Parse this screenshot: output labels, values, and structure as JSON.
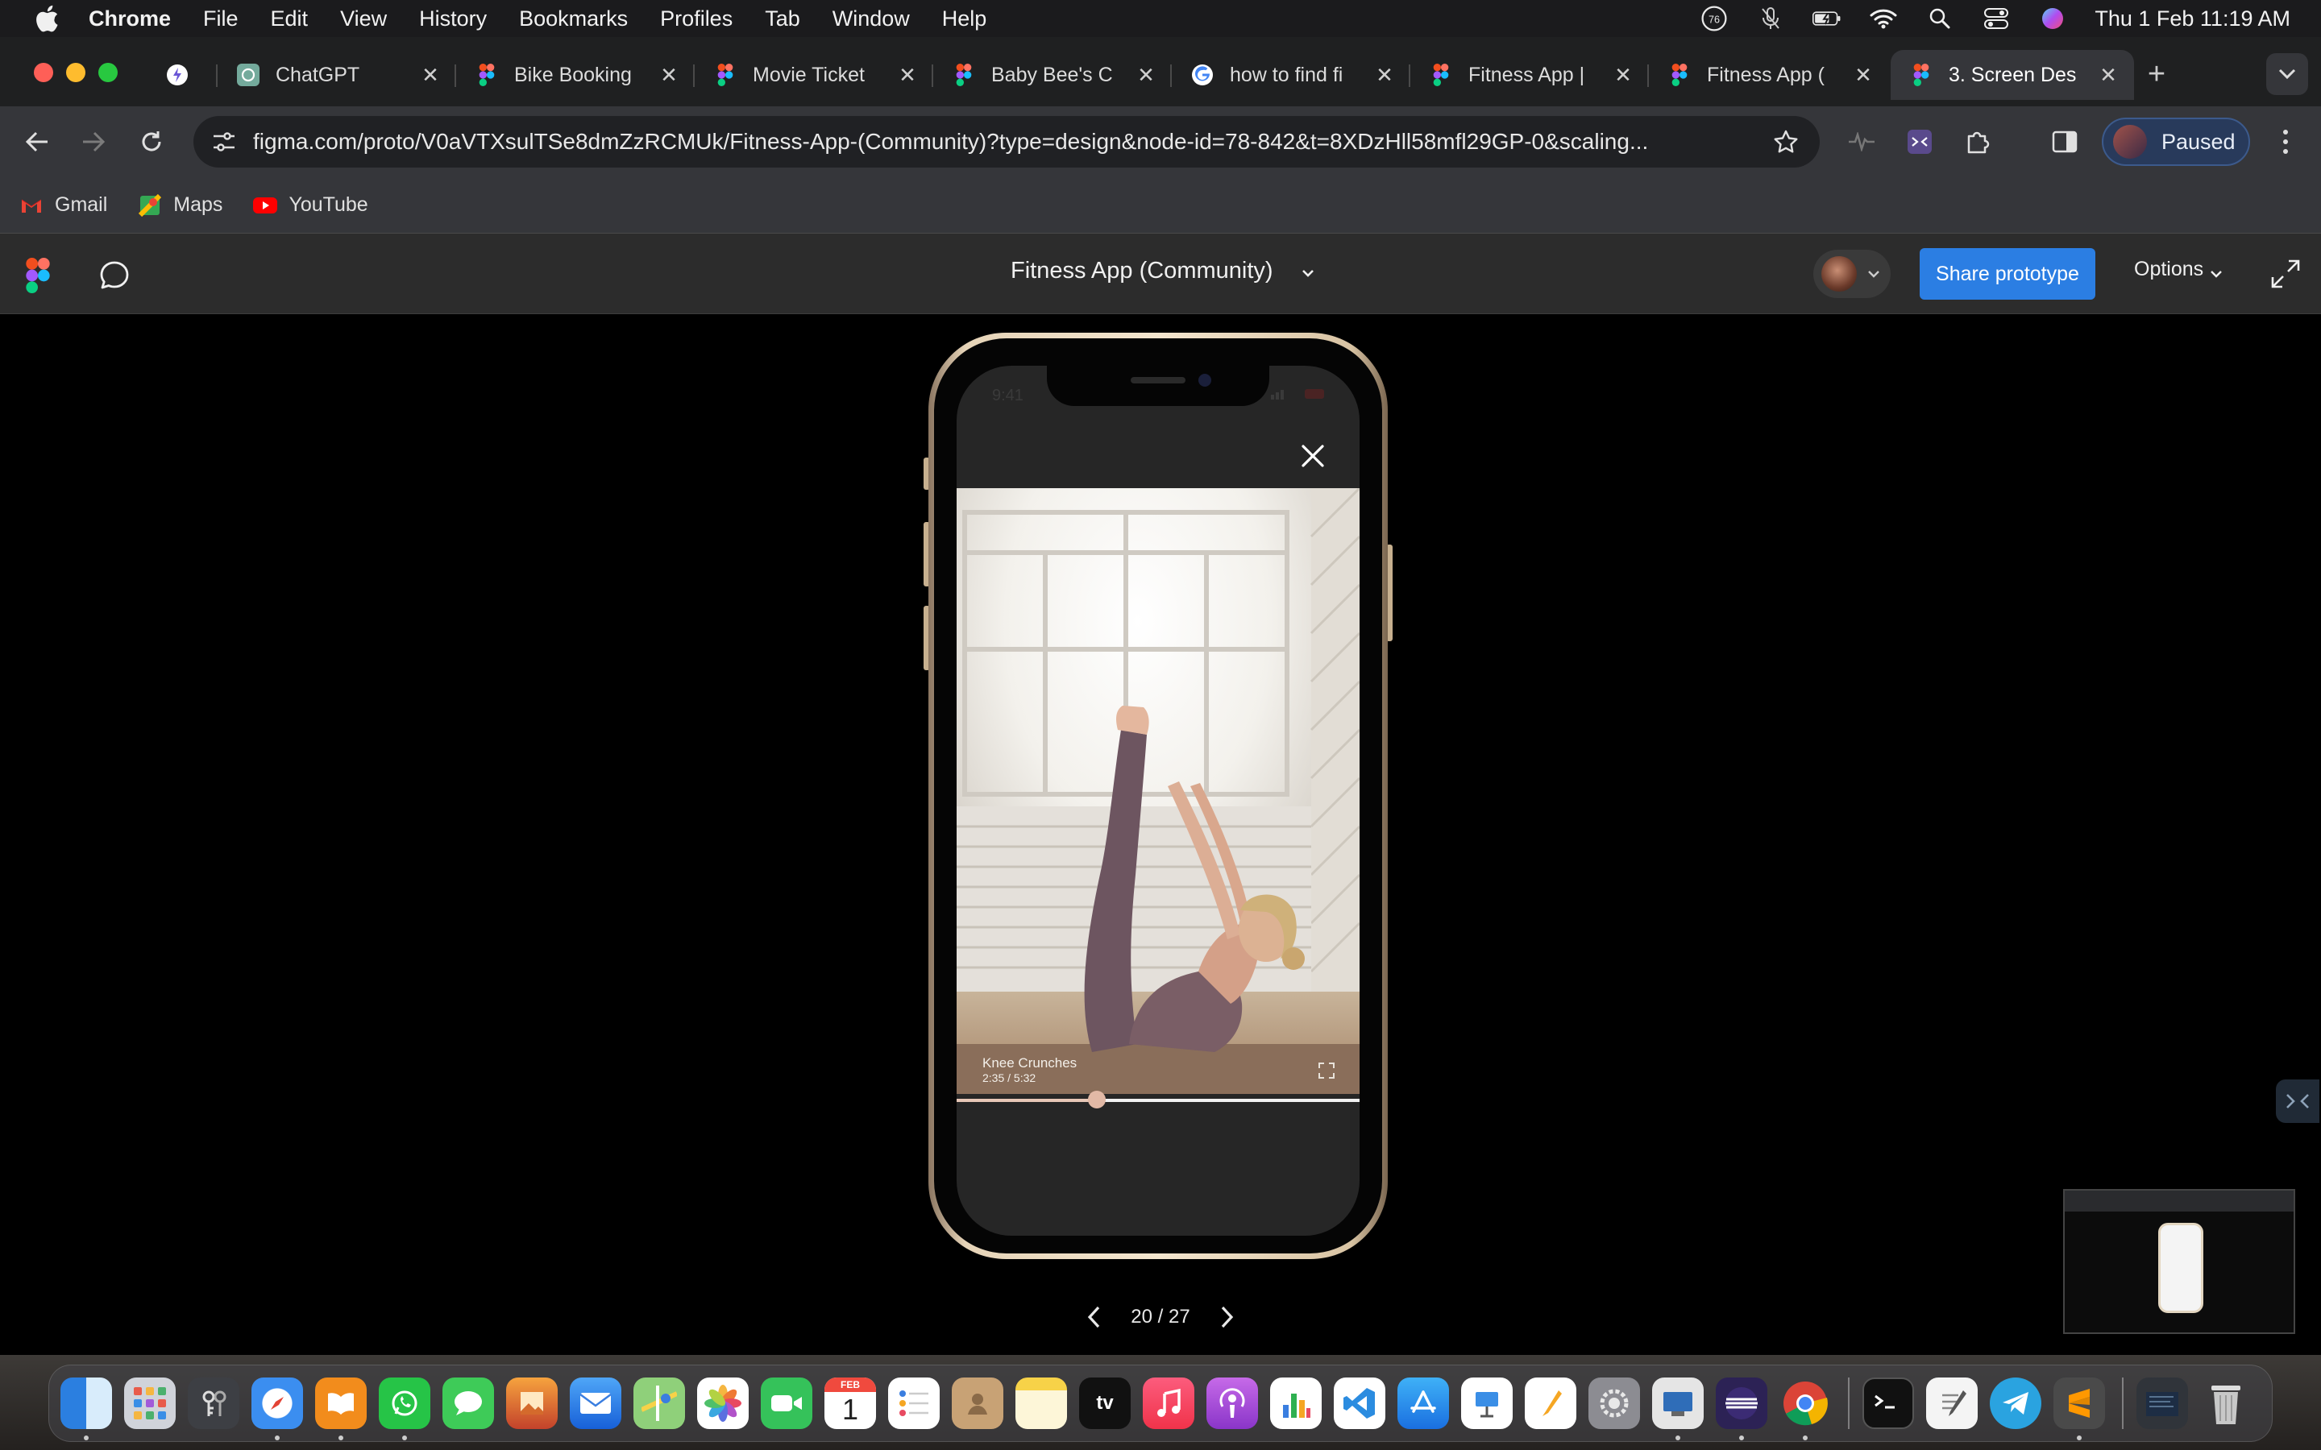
{
  "menubar": {
    "app": "Chrome",
    "items": [
      "File",
      "Edit",
      "View",
      "History",
      "Bookmarks",
      "Profiles",
      "Tab",
      "Window",
      "Help"
    ],
    "notification_badge": "76",
    "clock": "Thu 1 Feb  11:19 AM"
  },
  "tabs": [
    {
      "title": "",
      "icon": "extension-favicon"
    },
    {
      "title": "ChatGPT",
      "icon": "chatgpt-favicon"
    },
    {
      "title": "Bike Booking",
      "icon": "figma-favicon"
    },
    {
      "title": "Movie Ticket",
      "icon": "figma-favicon"
    },
    {
      "title": "Baby Bee's C",
      "icon": "figma-favicon"
    },
    {
      "title": "how to find fi",
      "icon": "google-favicon"
    },
    {
      "title": "Fitness App |",
      "icon": "figma-favicon"
    },
    {
      "title": "Fitness App (",
      "icon": "figma-favicon"
    },
    {
      "title": "3. Screen Des",
      "icon": "figma-favicon",
      "active": true
    }
  ],
  "toolbar": {
    "url": "figma.com/proto/V0aVTXsulTSe8dmZzRCMUk/Fitness-App-(Community)?type=design&node-id=78-842&t=8XDzHll58mfl29GP-0&scaling...",
    "profile_label": "Paused"
  },
  "bookmarks": [
    {
      "label": "Gmail",
      "icon": "gmail-icon"
    },
    {
      "label": "Maps",
      "icon": "maps-icon"
    },
    {
      "label": "YouTube",
      "icon": "youtube-icon"
    }
  ],
  "figma": {
    "file_title": "Fitness App (Community)",
    "share_label": "Share prototype",
    "options_label": "Options"
  },
  "phone": {
    "status_time": "9:41",
    "video": {
      "title": "Knee Crunches",
      "time": "2:35 / 5:32",
      "progress": 0.347
    }
  },
  "pager": {
    "label": "20 / 27"
  },
  "dock": {
    "apps": [
      "Finder",
      "Launchpad",
      "Keychain Access",
      "Safari",
      "Books",
      "WhatsApp",
      "Messages",
      "Preview",
      "Mail",
      "Maps",
      "Photos",
      "FaceTime",
      "Calendar",
      "Reminders",
      "Contacts",
      "Notes",
      "Apple TV",
      "Music",
      "Podcasts",
      "Numbers",
      "Visual Studio Code",
      "App Store",
      "Keynote",
      "Pages",
      "System Settings",
      "Preview",
      "Eclipse",
      "Google Chrome",
      "Terminal",
      "TextEdit",
      "Telegram",
      "Sublime Text",
      "Downloads",
      "Trash"
    ],
    "calendar_month": "FEB",
    "calendar_day": "1",
    "tv_label": "tv"
  },
  "colors": {
    "share_button": "#2b7ee3",
    "profile_pill": "#283a5b",
    "progress_knob": "#e2b9a6"
  }
}
